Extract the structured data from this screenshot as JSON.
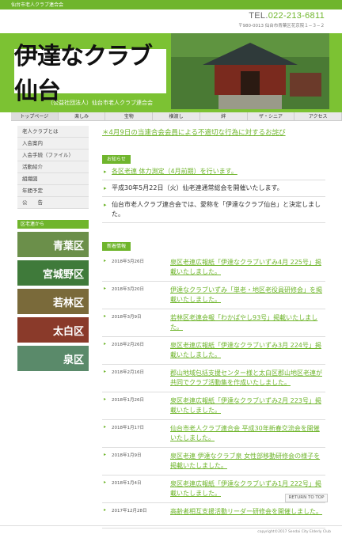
{
  "header": {
    "top_title": "仙台市老人クラブ連合会",
    "tel": "TEL.022-213-6811",
    "tel_prefix": "TEL.",
    "tel_number": "022-213-6811",
    "address": "〒980-0013 仙台市青葉区花京院１−３−２",
    "logo_text": "伊達なクラブ仙台",
    "org_name": "（公益社団法人）仙台市老人クラブ連合会"
  },
  "nav": [
    "トップページ",
    "楽しみ",
    "宝物",
    "横渡し",
    "絆",
    "ザ・シニア",
    "アクセス"
  ],
  "sidebar": {
    "items": [
      "老人クラブとは",
      "入会案内",
      "入会手続（ファイル）",
      "活動紹介",
      "組織図",
      "年間予定",
      "公　　告"
    ],
    "wards_label": "区老連から",
    "wards": [
      "青葉区",
      "宮城野区",
      "若林区",
      "太白区",
      "泉区"
    ]
  },
  "main": {
    "apology": "＊4月9日の当連合会会員による不適切な行為に対するお詫び",
    "notices_label": "お知らせ",
    "notices": [
      "各区老連 体力測定（4月前期）を行います。",
      "平成30年5月22日（火）仙老連通常総会を開催いたします。",
      "仙台市老人クラブ連合会では、愛称を「伊達なクラブ仙台」と決定しました。"
    ],
    "news_label": "新着情報",
    "news": [
      {
        "date": "2018年3月26日",
        "text": "泉区老連広報紙「伊達なクラブいずみ4月 225号」掲載いたしました。"
      },
      {
        "date": "2018年3月20日",
        "text": "伊達なクラブいずみ「単老・地区老役員研修会」を掲載いたしました。"
      },
      {
        "date": "2018年3月9日",
        "text": "若林区老連会報「わかばやし93号」掲載いたしました。"
      },
      {
        "date": "2018年2月26日",
        "text": "泉区老連広報紙「伊達なクラブいずみ3月 224号」掲載いたしました。"
      },
      {
        "date": "2018年2月16日",
        "text": "郡山地域包括支援センター様と太白区郡山地区老連が共同でクラブ活動集を作成いたしました。"
      },
      {
        "date": "2018年1月26日",
        "text": "泉区老連広報紙「伊達なクラブいずみ2月 223号」掲載いたしました。"
      },
      {
        "date": "2018年1月17日",
        "text": "仙台市老人クラブ連合会 平成30年新春交流会を開催いたしました。"
      },
      {
        "date": "2018年1月9日",
        "text": "泉区老連 伊達なクラブ泉 女性部移動研修会の様子を掲載いたしました。"
      },
      {
        "date": "2018年1月4日",
        "text": "泉区老連広報紙「伊達なクラブいずみ1月 222号」掲載いたしました。"
      },
      {
        "date": "2017年12月28日",
        "text": "高齢者相互支援活動リーダー研修会を開催しました。"
      }
    ]
  },
  "return_top": "RETURN TO TOP",
  "footer": "copyright©2017 Sendai City Elderly Club",
  "colors": {
    "accent": "#6fb52c"
  }
}
